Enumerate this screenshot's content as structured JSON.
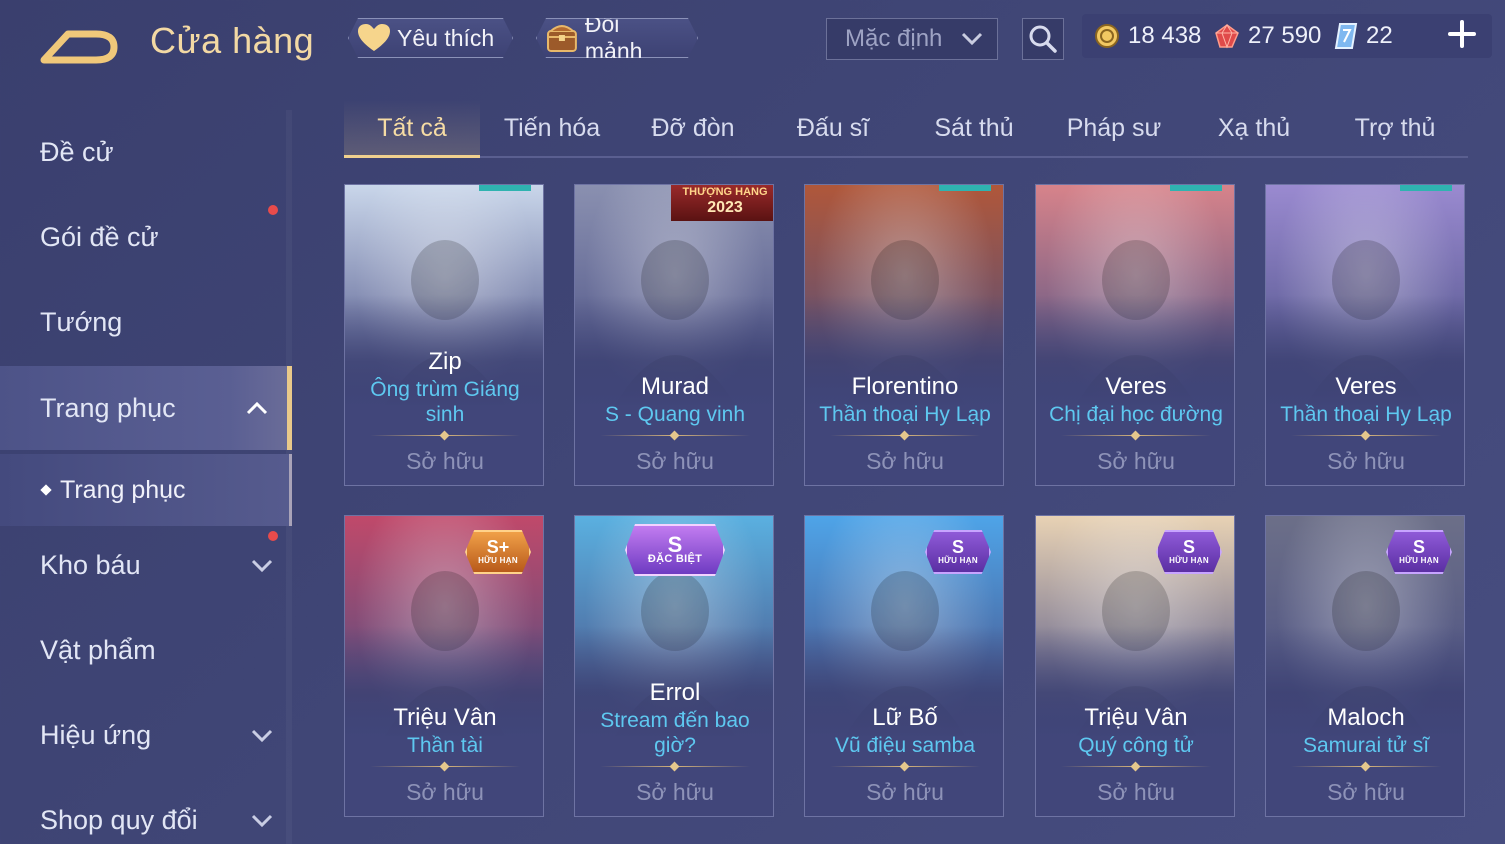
{
  "header": {
    "title": "Cửa hàng",
    "favorite_label": "Yêu thích",
    "exchange_label": "Đổi mảnh",
    "sort": {
      "selected": "Mặc định"
    },
    "currencies": [
      {
        "icon": "gold-coin-icon",
        "value": "18 438"
      },
      {
        "icon": "ruby-gem-icon",
        "value": "27 590"
      },
      {
        "icon": "voucher-icon",
        "value": "22"
      }
    ]
  },
  "sidebar": {
    "items": [
      {
        "label": "Đề cử"
      },
      {
        "label": "Gói đề cử"
      },
      {
        "label": "Tướng"
      },
      {
        "label": "Trang phục"
      },
      {
        "label": "Kho báu"
      },
      {
        "label": "Vật phẩm"
      },
      {
        "label": "Hiệu ứng"
      },
      {
        "label": "Shop quy đổi"
      }
    ],
    "sub_item": "Trang phục"
  },
  "tabs": [
    "Tất cả",
    "Tiến hóa",
    "Đỡ đòn",
    "Đấu sĩ",
    "Sát thủ",
    "Pháp sư",
    "Xạ thủ",
    "Trợ thủ"
  ],
  "cards": [
    {
      "hero": "Zip",
      "skin": "Ông trùm Giáng sinh",
      "status": "Sở hữu",
      "accent": "#c9d6ea"
    },
    {
      "hero": "Murad",
      "skin": "S - Quang vinh",
      "status": "Sở hữu",
      "accent": "#8a90b0",
      "ribbon_top": "THƯỢNG HẠNG",
      "ribbon_year": "2023"
    },
    {
      "hero": "Florentino",
      "skin": "Thần thoại Hy Lạp",
      "status": "Sở hữu",
      "accent": "#b0573a"
    },
    {
      "hero": "Veres",
      "skin": "Chị đại học đường",
      "status": "Sở hữu",
      "accent": "#d7838a"
    },
    {
      "hero": "Veres",
      "skin": "Thần thoại Hy Lạp",
      "status": "Sở hữu",
      "accent": "#9a8ad0"
    },
    {
      "hero": "Triệu Vân",
      "skin": "Thần tài",
      "status": "Sở hữu",
      "accent": "#c0496a",
      "badge_top": "S+",
      "badge_bot": "HỮU HẠN"
    },
    {
      "hero": "Errol",
      "skin": "Stream đến bao giờ?",
      "status": "Sở hữu",
      "accent": "#5ab0e0",
      "badge_top": "S",
      "badge_bot": "ĐẶC BIỆT"
    },
    {
      "hero": "Lữ Bố",
      "skin": "Vũ điệu samba",
      "status": "Sở hữu",
      "accent": "#4ea4e8",
      "badge_top": "S",
      "badge_bot": "HỮU HẠN"
    },
    {
      "hero": "Triệu Vân",
      "skin": "Quý công tử",
      "status": "Sở hữu",
      "accent": "#e8d2b4",
      "badge_top": "S",
      "badge_bot": "HỮU HẠN"
    },
    {
      "hero": "Maloch",
      "skin": "Samurai tử sĩ",
      "status": "Sở hữu",
      "accent": "#6c6f88",
      "badge_top": "S",
      "badge_bot": "HỮU HẠN"
    }
  ]
}
